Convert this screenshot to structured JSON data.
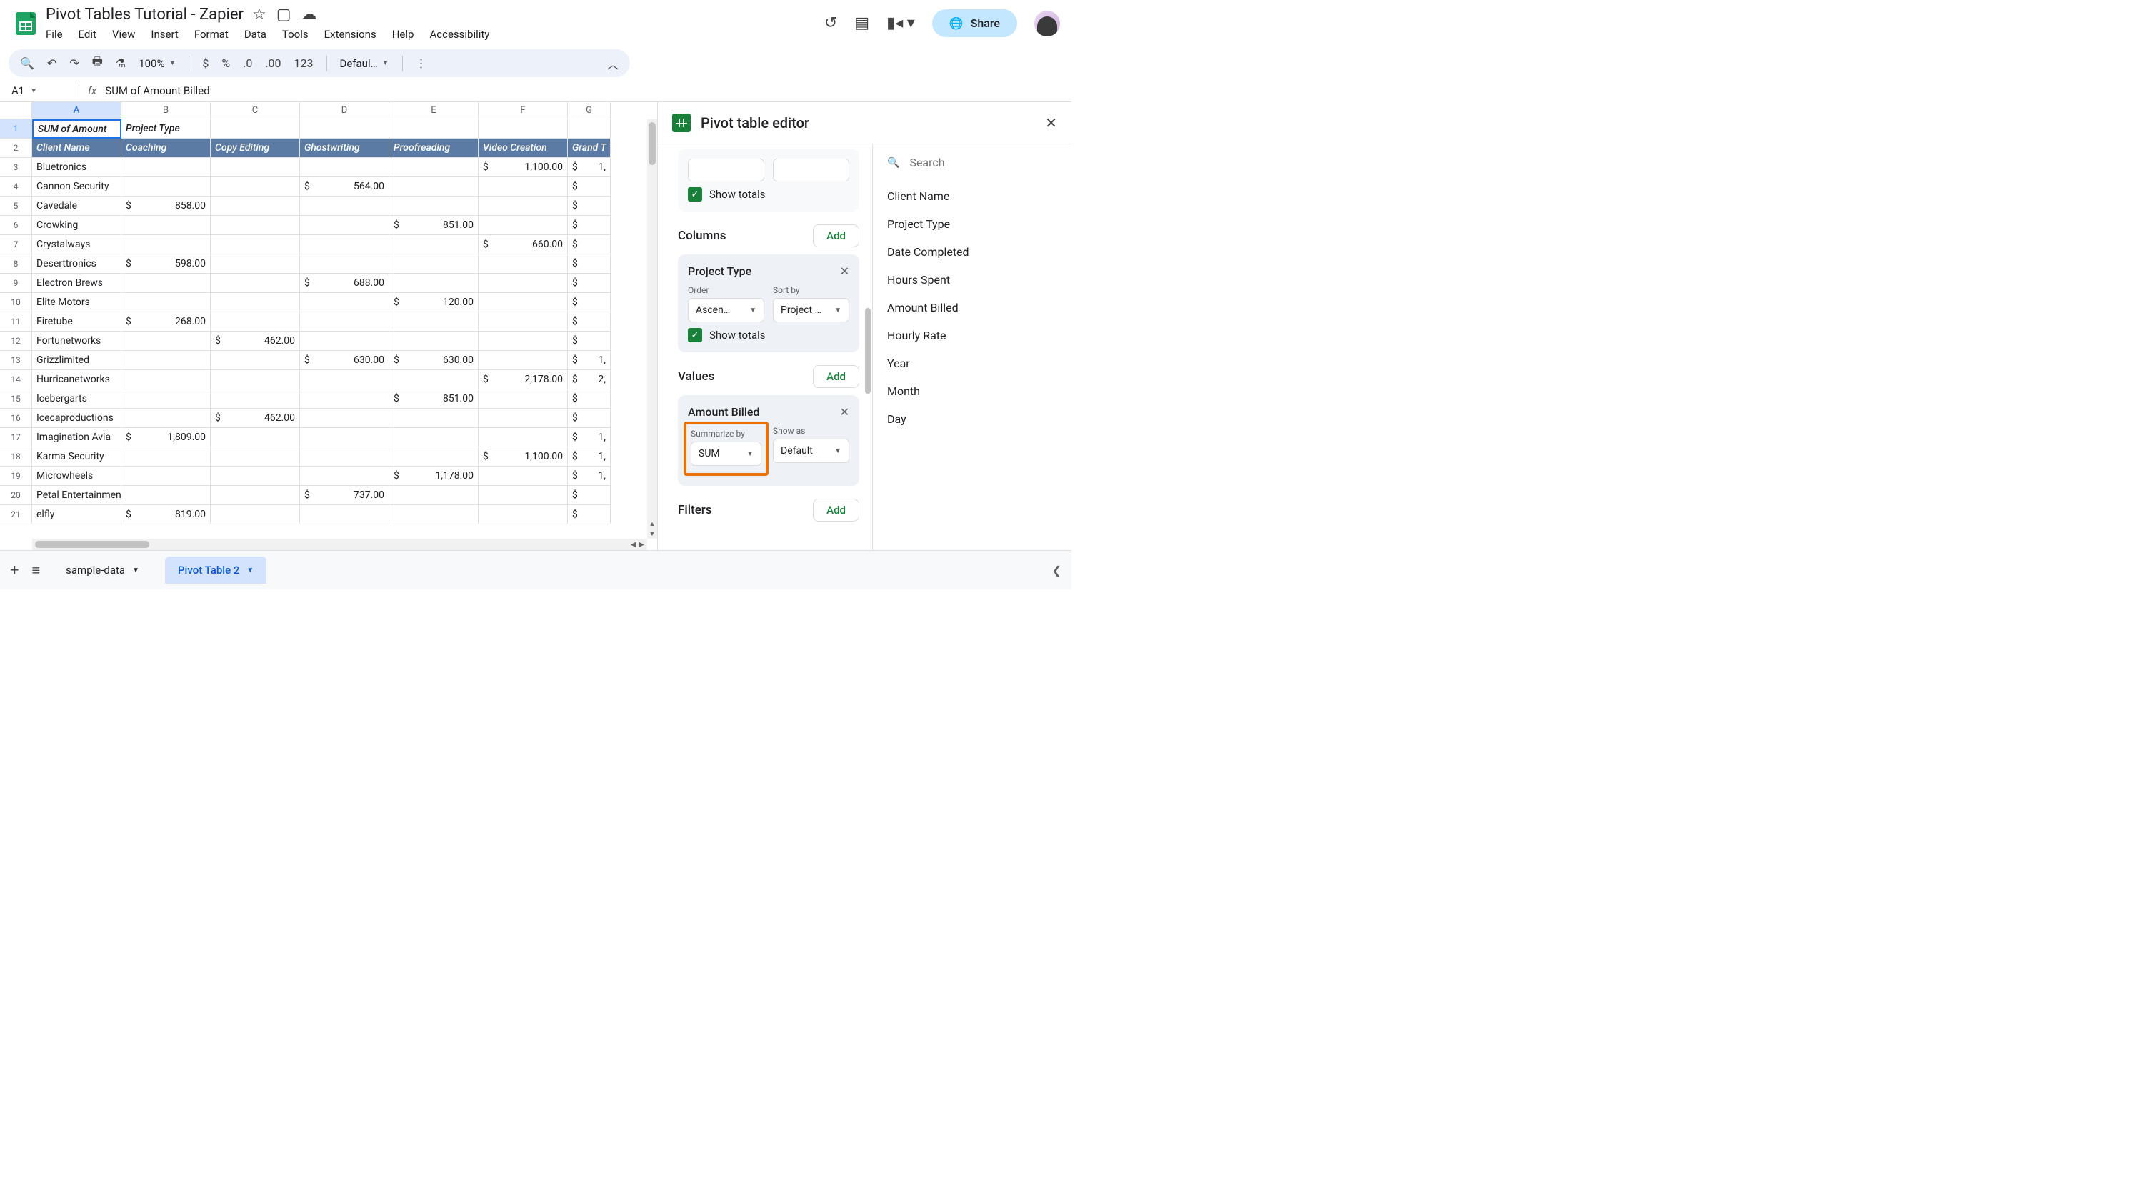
{
  "doc_title": "Pivot Tables Tutorial - Zapier",
  "menu": [
    "File",
    "Edit",
    "View",
    "Insert",
    "Format",
    "Data",
    "Tools",
    "Extensions",
    "Help",
    "Accessibility"
  ],
  "share_label": "Share",
  "toolbar": {
    "zoom": "100%",
    "number_format": "123",
    "font": "Defaul…"
  },
  "name_box": "A1",
  "formula": "SUM of  Amount Billed",
  "columns": [
    "A",
    "B",
    "C",
    "D",
    "E",
    "F",
    "G"
  ],
  "row1": {
    "A": "SUM of  Amount",
    "B": "Project Type"
  },
  "row2": {
    "A": "Client Name",
    "B": "Coaching",
    "C": "Copy Editing",
    "D": "Ghostwriting",
    "E": "Proofreading",
    "F": "Video Creation",
    "G": "Grand T"
  },
  "data_rows": [
    {
      "n": 3,
      "A": "Bluetronics",
      "F": "$ 1,100.00",
      "G": "$ 1,"
    },
    {
      "n": 4,
      "A": "Cannon Security",
      "D": "$ 564.00",
      "G": "$"
    },
    {
      "n": 5,
      "A": "Cavedale",
      "B": "$ 858.00",
      "G": "$"
    },
    {
      "n": 6,
      "A": "Crowking",
      "E": "$ 851.00",
      "G": "$"
    },
    {
      "n": 7,
      "A": "Crystalways",
      "F": "$ 660.00",
      "G": "$"
    },
    {
      "n": 8,
      "A": "Deserttronics",
      "B": "$ 598.00",
      "G": "$"
    },
    {
      "n": 9,
      "A": "Electron Brews",
      "D": "$ 688.00",
      "G": "$"
    },
    {
      "n": 10,
      "A": "Elite Motors",
      "E": "$ 120.00",
      "G": "$"
    },
    {
      "n": 11,
      "A": "Firetube",
      "B": "$ 268.00",
      "G": "$"
    },
    {
      "n": 12,
      "A": "Fortunetworks",
      "C": "$ 462.00",
      "G": "$"
    },
    {
      "n": 13,
      "A": "Grizzlimited",
      "D": "$ 630.00",
      "E": "$ 630.00",
      "G": "$ 1,"
    },
    {
      "n": 14,
      "A": "Hurricanetworks",
      "F": "$ 2,178.00",
      "G": "$ 2,"
    },
    {
      "n": 15,
      "A": "Icebergarts",
      "E": "$ 851.00",
      "G": "$"
    },
    {
      "n": 16,
      "A": "Icecaproductions",
      "C": "$ 462.00",
      "G": "$"
    },
    {
      "n": 17,
      "A": "Imagination Avia",
      "B": "$ 1,809.00",
      "G": "$ 1,"
    },
    {
      "n": 18,
      "A": "Karma Security",
      "F": "$ 1,100.00",
      "G": "$ 1,"
    },
    {
      "n": 19,
      "A": "Microwheels",
      "E": "$ 1,178.00",
      "G": "$ 1,"
    },
    {
      "n": 20,
      "A": "Petal Entertainment",
      "D": "$ 737.00",
      "G": "$"
    },
    {
      "n": 21,
      "A": "elfly",
      "B": "$ 819.00",
      "G": "$"
    }
  ],
  "sidebar": {
    "title": "Pivot table editor",
    "show_totals": "Show totals",
    "columns_label": "Columns",
    "add": "Add",
    "columns_card": {
      "title": "Project Type",
      "order_label": "Order",
      "order_value": "Ascen…",
      "sort_label": "Sort by",
      "sort_value": "Project …"
    },
    "values_label": "Values",
    "values_card": {
      "title": "Amount Billed",
      "summarize_label": "Summarize by",
      "summarize_value": "SUM",
      "showas_label": "Show as",
      "showas_value": "Default"
    },
    "filters_label": "Filters",
    "search_placeholder": "Search",
    "fields": [
      "Client Name",
      "Project Type",
      "Date Completed",
      "Hours Spent",
      "Amount Billed",
      "Hourly Rate",
      "Year",
      "Month",
      "Day"
    ]
  },
  "tabs": {
    "sample": "sample-data",
    "pivot": "Pivot Table 2"
  }
}
